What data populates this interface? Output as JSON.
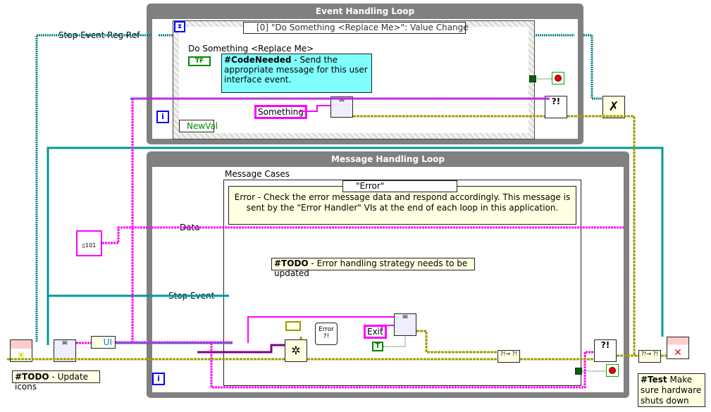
{
  "event_loop": {
    "title": "Event Handling Loop",
    "event_selector": "[0] \"Do Something <Replace Me>\": Value Change",
    "control_label": "Do Something <Replace Me>",
    "bool_terminal": "TF",
    "comment_bold": "#CodeNeeded",
    "comment_text": " - Send the appropriate message for this user interface event.",
    "string_constant": "Something",
    "event_data_node": "NewVal",
    "iteration_terminal": "i"
  },
  "message_loop": {
    "title": "Message Handling Loop",
    "case_label": "Message Cases",
    "case_selector": "\"Error\"",
    "case_comment": "Error - Check the error message data and respond accordingly. This message is sent by the \"Error Handler\" VIs at the end of each loop in this application.",
    "todo_bold": "#TODO",
    "todo_text": " - Error handling strategy needs to be updated",
    "exit_constant": "Exit",
    "true_constant": "T",
    "error_node": "Error ?!",
    "iteration_terminal": "i",
    "data_label": "Data",
    "stop_event_label": "Stop Event"
  },
  "left": {
    "stop_event_reg_ref_label": "Stop Event Reg Ref",
    "ui_constant": "UI",
    "todo_bold": "#TODO",
    "todo_text": " - Update icons"
  },
  "right": {
    "test_bold": "#Test",
    "test_text": " Make sure hardware shuts down"
  },
  "colors": {
    "loop_gray": "#808080",
    "wire_pink": "#ff00ff",
    "wire_teal": "#008080",
    "wire_error": "#a0a000",
    "comment_cyan": "#80ffff",
    "comment_yellow": "#ffffe1"
  }
}
